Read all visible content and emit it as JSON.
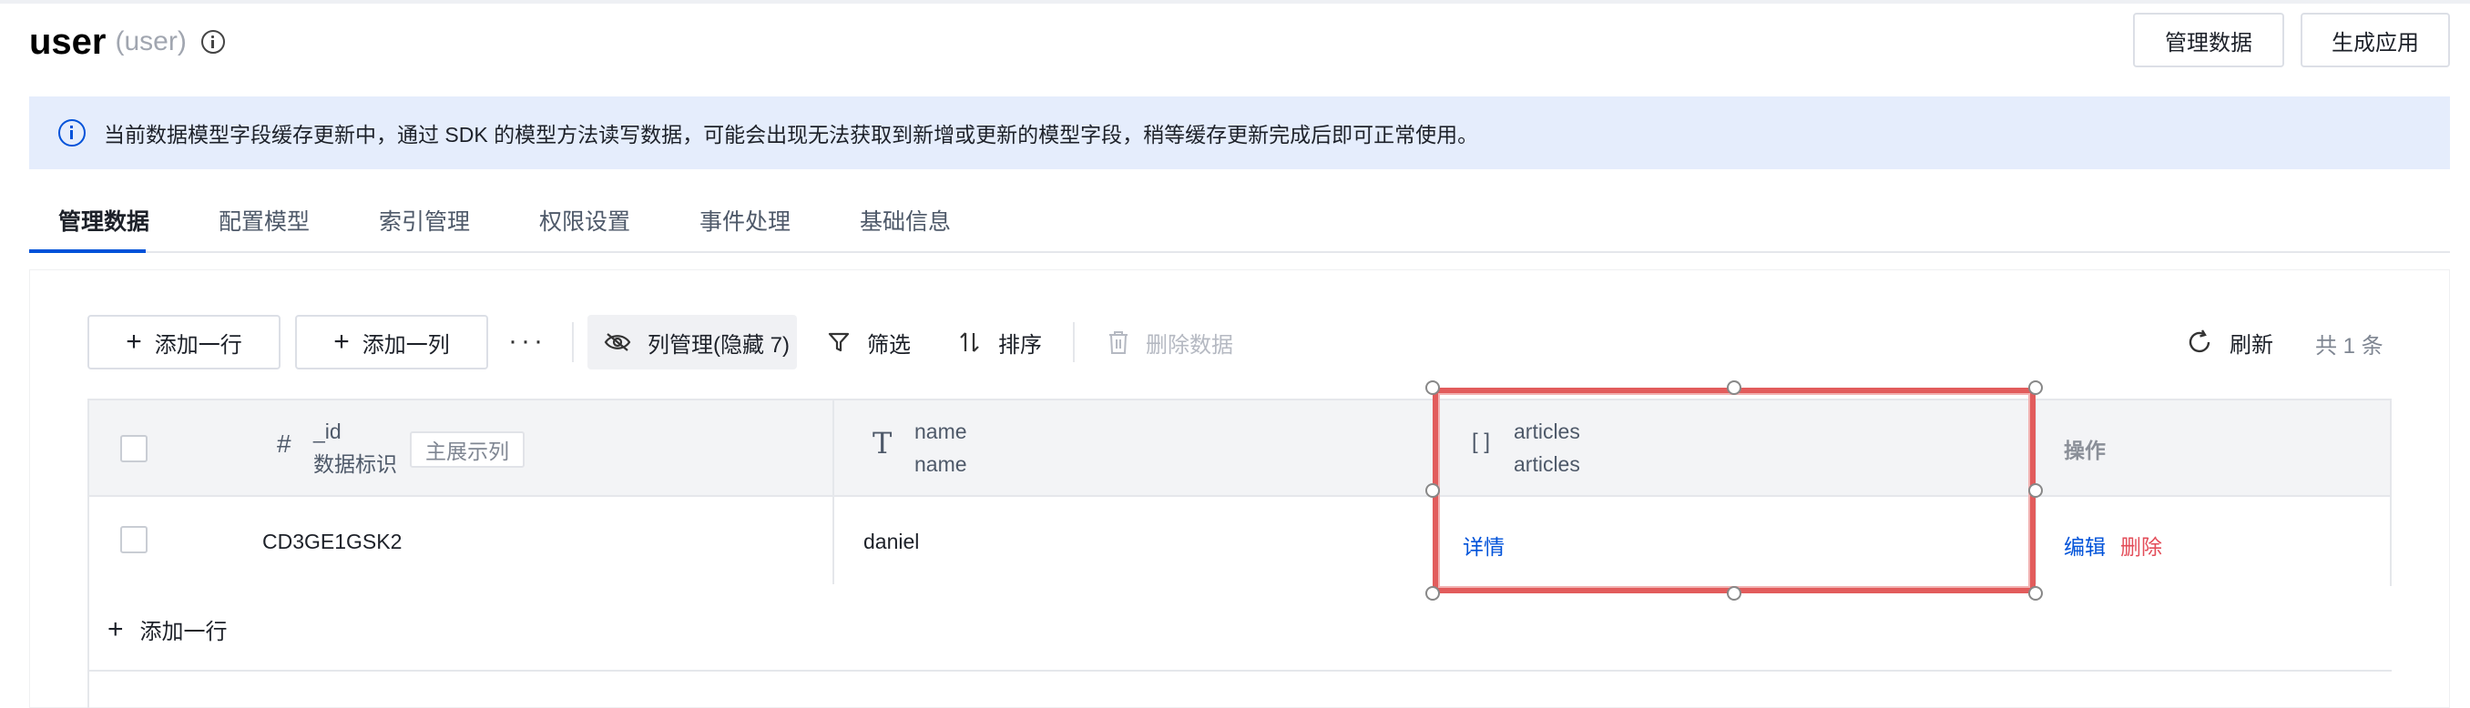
{
  "header": {
    "title": "user",
    "subtitle": "(user)",
    "manage_button": "管理数据",
    "generate_button": "生成应用"
  },
  "notice": {
    "text": "当前数据模型字段缓存更新中，通过 SDK 的模型方法读写数据，可能会出现无法获取到新增或更新的模型字段，稍等缓存更新完成后即可正常使用。"
  },
  "tabs": [
    {
      "label": "管理数据",
      "active": true
    },
    {
      "label": "配置模型",
      "active": false
    },
    {
      "label": "索引管理",
      "active": false
    },
    {
      "label": "权限设置",
      "active": false
    },
    {
      "label": "事件处理",
      "active": false
    },
    {
      "label": "基础信息",
      "active": false
    }
  ],
  "toolbar": {
    "add_row": "添加一行",
    "add_column": "添加一列",
    "more": "···",
    "column_manage": "列管理(隐藏 7)",
    "filter": "筛选",
    "sort": "排序",
    "delete_data": "删除数据",
    "refresh": "刷新",
    "total": "共 1 条"
  },
  "table": {
    "columns": [
      {
        "icon": "#",
        "field": "_id",
        "label": "数据标识",
        "badge": "主展示列"
      },
      {
        "icon": "T",
        "field": "name",
        "label": "name"
      },
      {
        "icon": "[ ]",
        "field": "articles",
        "label": "articles"
      },
      {
        "label": "操作"
      }
    ],
    "rows": [
      {
        "_id": "CD3GE1GSK2",
        "name": "daniel",
        "articles": "详情",
        "edit": "编辑",
        "delete": "删除"
      }
    ]
  },
  "footer": {
    "add_row": "添加一行"
  },
  "colors": {
    "accent": "#0052d9",
    "danger": "#e34d59",
    "notice_bg": "#e5edfc",
    "highlight": "#e25c5c"
  }
}
